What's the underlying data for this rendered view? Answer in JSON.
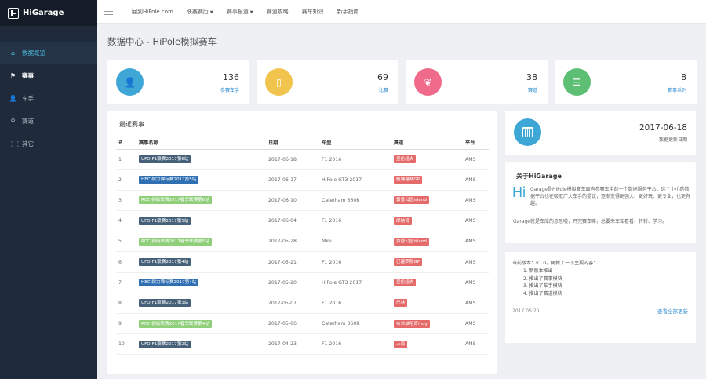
{
  "brand": {
    "name": "HiGarage"
  },
  "sidebar": {
    "items": [
      {
        "label": "数据概览",
        "icon": "home-icon",
        "glyph": "⌂"
      },
      {
        "label": "赛事",
        "icon": "flag-icon",
        "glyph": "⚑"
      },
      {
        "label": "车手",
        "icon": "user-icon",
        "glyph": "👤"
      },
      {
        "label": "赛道",
        "icon": "map-marker-icon",
        "glyph": "⚲"
      },
      {
        "label": "其它",
        "icon": "grid-icon",
        "glyph": "⋮⋮"
      }
    ]
  },
  "topnav": {
    "items": [
      {
        "label": "回到HiPole.com"
      },
      {
        "label": "联赛赛历",
        "caret": "▼"
      },
      {
        "label": "赛事报道",
        "caret": "▼"
      },
      {
        "label": "赛道攻略"
      },
      {
        "label": "赛车知识"
      },
      {
        "label": "新手指南"
      }
    ]
  },
  "page": {
    "title": "数据中心 - HiPole模拟赛车"
  },
  "stats": [
    {
      "value": "136",
      "label": "参赛车手",
      "color": "#3fa7d6",
      "icon": "user-icon",
      "glyph": "👤"
    },
    {
      "value": "69",
      "label": "比赛",
      "color": "#f0c44d",
      "icon": "mobile-icon",
      "glyph": "▯"
    },
    {
      "value": "38",
      "label": "赛道",
      "color": "#f06a8c",
      "icon": "leaf-icon",
      "glyph": "❦"
    },
    {
      "value": "8",
      "label": "赛事系列",
      "color": "#5cbf74",
      "icon": "list-icon",
      "glyph": "☰"
    }
  ],
  "races": {
    "title": "最近赛事",
    "columns": [
      "#",
      "赛事名称",
      "日期",
      "车型",
      "赛道",
      "平台"
    ],
    "rows": [
      {
        "n": "1",
        "series": "UFO F1联赛2017第6站",
        "type": "ufo",
        "date": "2017-06-18",
        "car": "F1 2016",
        "track": "墨伦组夫",
        "platform": "AMS"
      },
      {
        "n": "2",
        "series": "HEC 耐力锦标赛2017第5站",
        "type": "hec",
        "date": "2017-06-17",
        "car": "HiPole GT3 2017",
        "track": "纽博格林GP",
        "platform": "AMS"
      },
      {
        "n": "3",
        "series": "RCC 初级联赛2017春季联赛第6站",
        "type": "rcc",
        "date": "2017-06-10",
        "car": "Caterham 360R",
        "track": "黄昏公园island",
        "platform": "AMS"
      },
      {
        "n": "4",
        "series": "UFO F1联赛2017第5站",
        "type": "ufo",
        "date": "2017-06-04",
        "car": "F1 2016",
        "track": "摩纳哥",
        "platform": "AMS"
      },
      {
        "n": "5",
        "series": "RCC 初级联赛2017春季联赛第5站",
        "type": "rcc",
        "date": "2017-05-28",
        "car": "Mini",
        "track": "黄昏公园island",
        "platform": "AMS"
      },
      {
        "n": "6",
        "series": "UFO F1联赛2017第4站",
        "type": "ufo",
        "date": "2017-05-21",
        "car": "F1 2016",
        "track": "巴塞罗那GP",
        "platform": "AMS"
      },
      {
        "n": "7",
        "series": "HEC 耐力锦标赛2017第4站",
        "type": "hec",
        "date": "2017-05-20",
        "car": "HiPole GT3 2017",
        "track": "墨伦组夫",
        "platform": "AMS"
      },
      {
        "n": "8",
        "series": "UFO F1联赛2017第3站",
        "type": "ufo",
        "date": "2017-05-07",
        "car": "F1 2016",
        "track": "巴林",
        "platform": "AMS"
      },
      {
        "n": "9",
        "series": "RCC 初级联赛2017春季联赛第4站",
        "type": "rcc",
        "date": "2017-05-06",
        "car": "Caterham 360R",
        "track": "布兰兹哈奇Indy",
        "platform": "AMS"
      },
      {
        "n": "10",
        "series": "UFO F1联赛2017第2站",
        "type": "ufo",
        "date": "2017-04-23",
        "car": "F1 2016",
        "track": "上海",
        "platform": "AMS"
      }
    ]
  },
  "update_card": {
    "date": "2017-06-18",
    "label": "数据更新日期",
    "icon": "calendar-icon"
  },
  "about": {
    "title": "关于HiGarage",
    "hi": "Hi",
    "p1": "Garage是HiPole模拟赛车面向参赛车手的一个数据服务平台。这个小小的数据平台也在吸取广大车手的提议，逐渐变得更强大、更好玩、更专业，也更有趣。",
    "p2": "Garage就是车库的意思啦，开完赛车嘛，总要来车库看看、转转、学习。"
  },
  "changelog": {
    "head": "当前版本：v1.0。更新了一下主要内容：",
    "items": [
      "1. 新版本推出",
      "2. 推出了赛事模块",
      "3. 推出了车手模块",
      "4. 推出了赛道模块"
    ],
    "date": "2017.06.20",
    "link": "查看全部更新"
  }
}
